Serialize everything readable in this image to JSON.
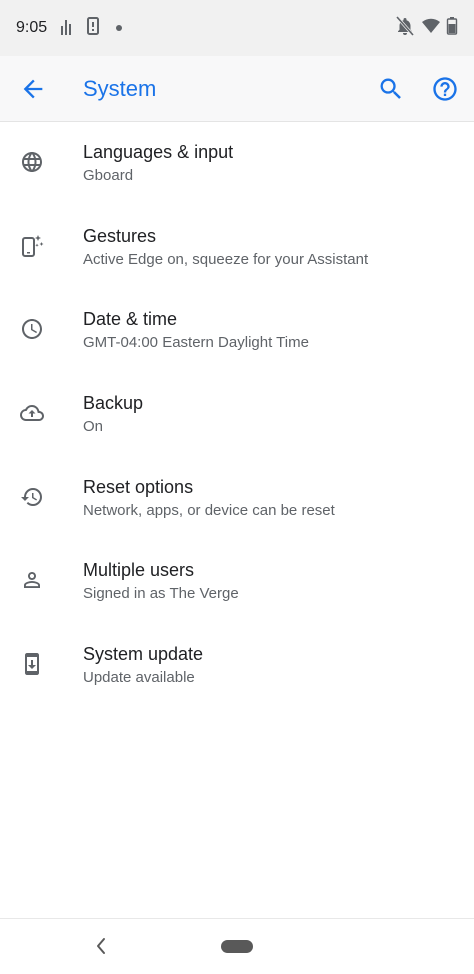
{
  "status_bar": {
    "time": "9:05",
    "left_icons": [
      "signal-bars-icon",
      "phone-badge-icon",
      "dot-icon"
    ],
    "right_icons": [
      "notifications-off-icon",
      "wifi-icon",
      "battery-icon"
    ]
  },
  "app_bar": {
    "title": "System",
    "back_icon": "arrow-back-icon",
    "search_icon": "search-icon",
    "help_icon": "help-icon",
    "accent_color": "#1a73e8"
  },
  "settings": {
    "items": [
      {
        "icon": "globe-icon",
        "title": "Languages & input",
        "subtitle": "Gboard"
      },
      {
        "icon": "gestures-icon",
        "title": "Gestures",
        "subtitle": "Active Edge on, squeeze for your Assistant"
      },
      {
        "icon": "clock-icon",
        "title": "Date & time",
        "subtitle": "GMT-04:00 Eastern Daylight Time"
      },
      {
        "icon": "cloud-backup-icon",
        "title": "Backup",
        "subtitle": "On"
      },
      {
        "icon": "history-icon",
        "title": "Reset options",
        "subtitle": "Network, apps, or device can be reset"
      },
      {
        "icon": "person-icon",
        "title": "Multiple users",
        "subtitle": "Signed in as The Verge"
      },
      {
        "icon": "system-update-icon",
        "title": "System update",
        "subtitle": "Update available"
      }
    ]
  },
  "nav_bar": {
    "back_icon": "nav-back-icon",
    "home_icon": "home-pill-icon"
  }
}
